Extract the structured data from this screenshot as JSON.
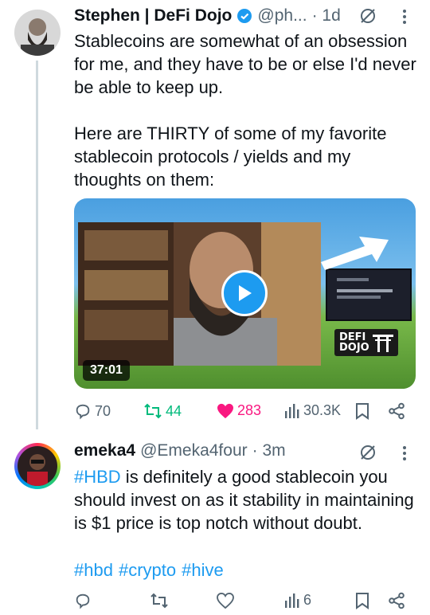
{
  "tweet1": {
    "display_name": "Stephen | DeFi Dojo",
    "handle": "@ph...",
    "time": "· 1d",
    "text": "Stablecoins are somewhat of an obsession for me, and they have to be or else I'd never be able to keep up.\n\nHere are THIRTY of some of my favorite stablecoin protocols / yields and my thoughts on them:",
    "video": {
      "duration": "37:01",
      "brand_text_line1": "DEFI",
      "brand_text_line2": "DOJO"
    },
    "stats": {
      "replies": "70",
      "retweets": "44",
      "likes": "283",
      "views": "30.3K"
    },
    "colors": {
      "retweet": "#00ba7c",
      "like": "#f91880",
      "verified": "#1d9bf0"
    }
  },
  "tweet2": {
    "display_name": "emeka4",
    "handle": "@Emeka4four",
    "time": "· 3m",
    "hashtag_lead": "#HBD",
    "text": " is definitely a good stablecoin you should invest on as it stability in maintaining is $1 price is top notch without doubt.",
    "hashtags": [
      "#hbd",
      "#crypto",
      "#hive"
    ],
    "stats": {
      "views": "6"
    }
  }
}
